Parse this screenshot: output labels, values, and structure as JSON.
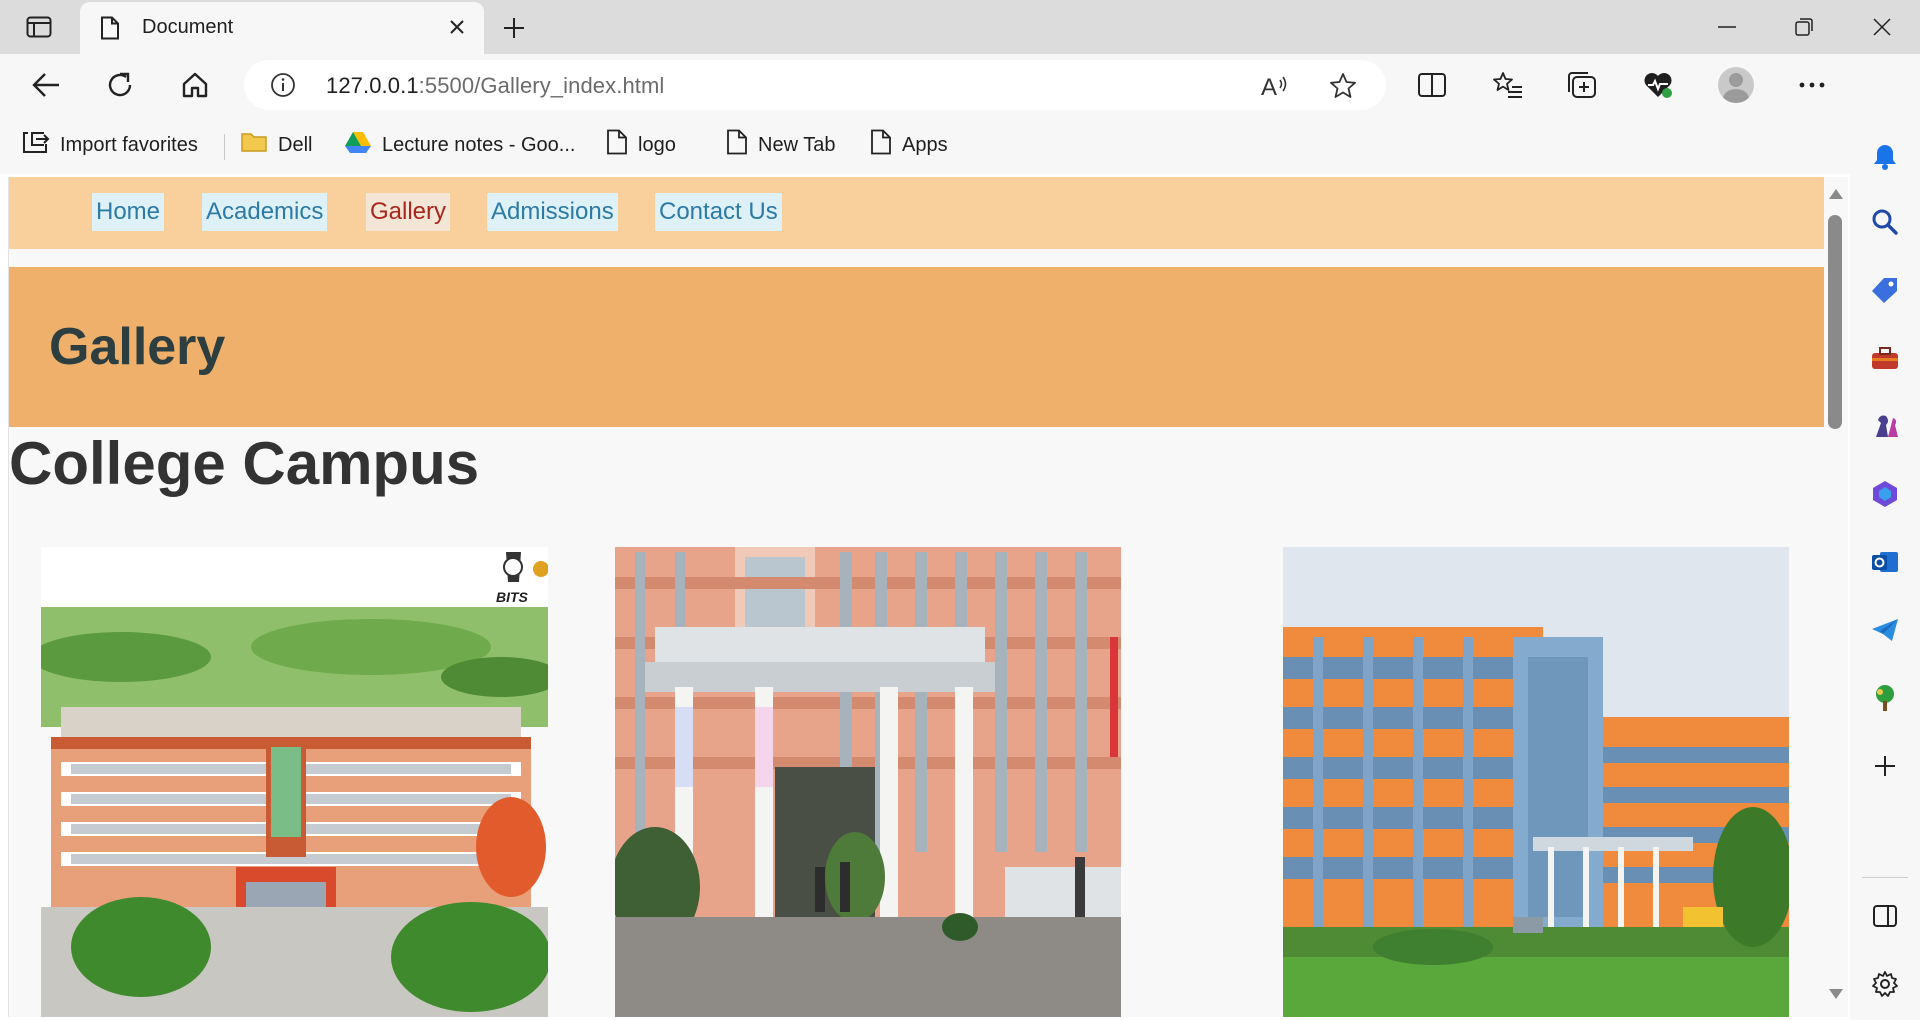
{
  "browser": {
    "tab_title": "Document",
    "url_host": "127.0.0.1",
    "url_path": ":5500/Gallery_index.html"
  },
  "favorites": [
    {
      "label": "Import favorites",
      "icon": "import-icon"
    },
    {
      "label": "Dell",
      "icon": "folder-icon"
    },
    {
      "label": "Lecture notes - Goo...",
      "icon": "google-drive-icon"
    },
    {
      "label": "logo",
      "icon": "page-icon"
    },
    {
      "label": "New Tab",
      "icon": "page-icon"
    },
    {
      "label": "Apps",
      "icon": "page-icon"
    }
  ],
  "site": {
    "nav": [
      {
        "label": "Home",
        "active": false
      },
      {
        "label": "Academics",
        "active": false
      },
      {
        "label": "Gallery",
        "active": true
      },
      {
        "label": "Admissions",
        "active": false
      },
      {
        "label": "Contact Us",
        "active": false
      }
    ],
    "banner_title": "Gallery",
    "section_title": "College Campus",
    "photos": [
      {
        "name": "campus-photo-aerial",
        "logo_text": "BITS"
      },
      {
        "name": "campus-photo-entrance"
      },
      {
        "name": "campus-photo-blue-building"
      }
    ]
  },
  "colors": {
    "nav_bg": "#f9cf9c",
    "banner_bg": "#efb06c",
    "link": "#2d7aa6",
    "link_active": "#a8261c",
    "link_bg": "#ddf1f6"
  }
}
